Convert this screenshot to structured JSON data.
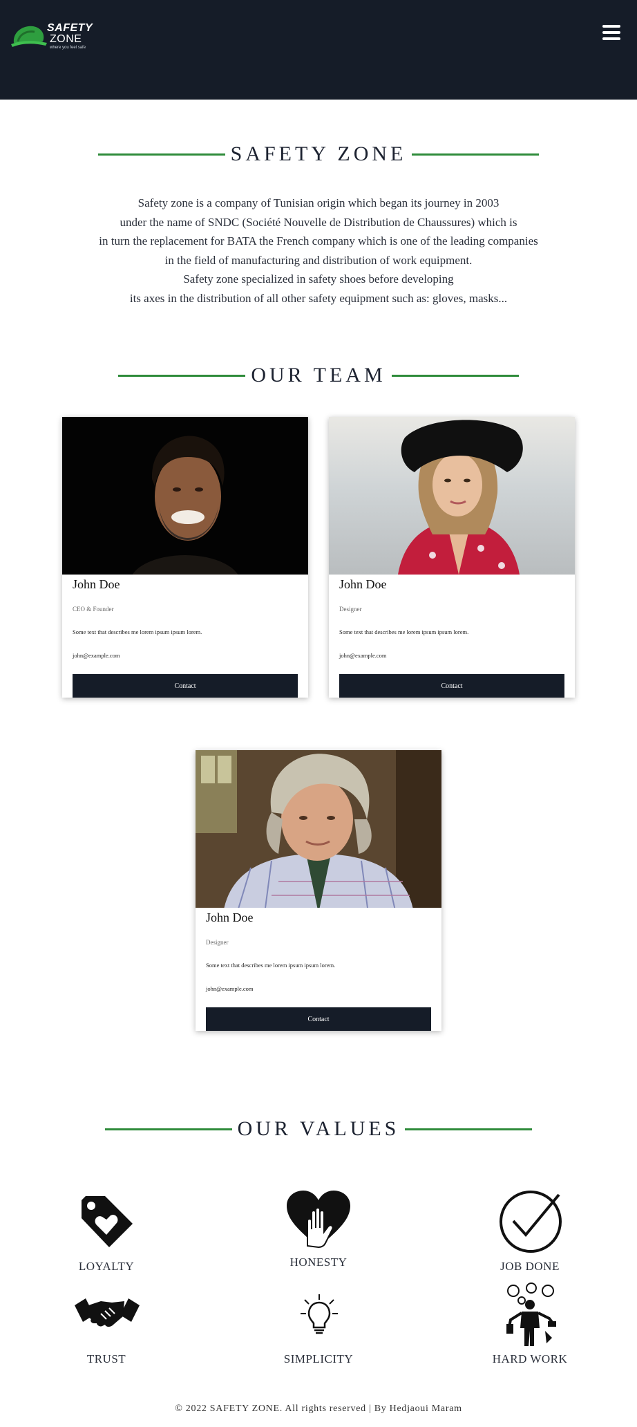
{
  "header": {
    "brand_line1": "SAFETY",
    "brand_line2": "ZONE",
    "tagline": "where you feel safe",
    "menu_icon": "hamburger-menu-icon"
  },
  "about": {
    "title": "SAFETY ZONE",
    "lines": [
      "Safety zone is a company of Tunisian origin which began its journey in 2003",
      "under the name of SNDC (Société Nouvelle de Distribution de Chaussures) which is",
      "in turn the replacement for BATA the French company which is one of the leading companies",
      "in the field of manufacturing and distribution of work equipment.",
      "Safety zone specialized in safety shoes before developing",
      "its axes in the distribution of all other safety equipment such as: gloves, masks..."
    ]
  },
  "team": {
    "title": "OUR TEAM",
    "members": [
      {
        "name": "John Doe",
        "role": "CEO & Founder",
        "description": "Some text that describes me lorem ipsum ipsum lorem.",
        "email": "john@example.com",
        "button": "Contact"
      },
      {
        "name": "John Doe",
        "role": "Designer",
        "description": "Some text that describes me lorem ipsum ipsum lorem.",
        "email": "john@example.com",
        "button": "Contact"
      },
      {
        "name": "John Doe",
        "role": "Designer",
        "description": "Some text that describes me lorem ipsum ipsum lorem.",
        "email": "john@example.com",
        "button": "Contact"
      }
    ]
  },
  "values": {
    "title": "OUR VALUES",
    "items": [
      {
        "label": "LOYALTY",
        "icon": "tag-heart-icon"
      },
      {
        "label": "HONESTY",
        "icon": "heart-hand-icon"
      },
      {
        "label": "JOB DONE",
        "icon": "check-circle-icon"
      },
      {
        "label": "TRUST",
        "icon": "handshake-icon"
      },
      {
        "label": "SIMPLICITY",
        "icon": "lightbulb-icon"
      },
      {
        "label": "HARD WORK",
        "icon": "multitasking-person-icon"
      }
    ]
  },
  "footer": {
    "text": "© 2022 SAFETY ZONE. All rights reserved | By Hedjaoui Maram"
  },
  "colors": {
    "header_bg": "#151c28",
    "accent_green": "#2e8b3a",
    "button_bg": "#151c28"
  }
}
